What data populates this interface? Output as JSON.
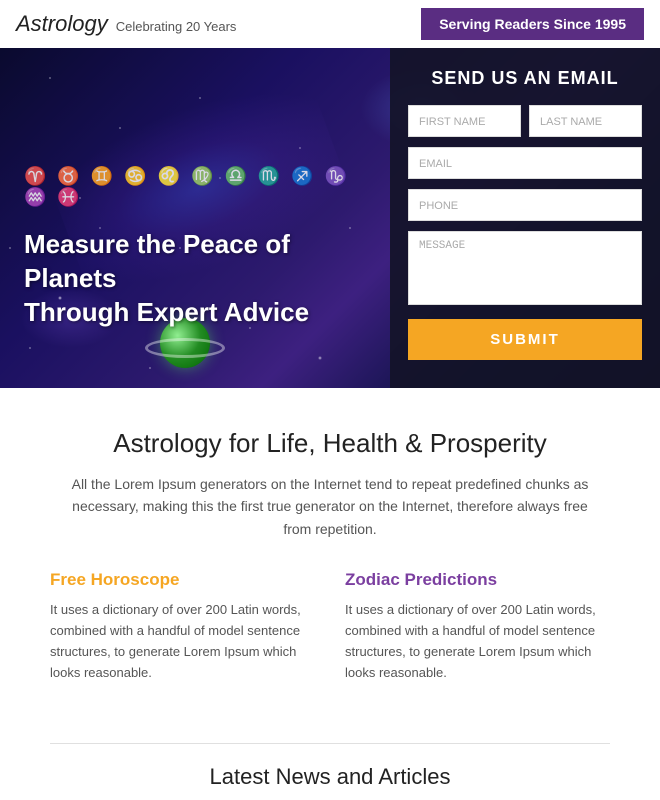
{
  "header": {
    "site_title": "Astrology",
    "site_subtitle": "Celebrating 20 Years",
    "tagline": "Serving Readers Since 1995"
  },
  "hero": {
    "zodiac_symbols": "♈ ♉ ♊ ♋ ♌ ♍ ♎ ♏ ♐ ♑ ♒ ♓",
    "title_line1": "Measure the Peace of Planets",
    "title_line2": "Through Expert Advice"
  },
  "form": {
    "title": "SEND US AN EMAIL",
    "first_name_placeholder": "FIRST NAME",
    "last_name_placeholder": "LAST NAME",
    "email_placeholder": "EMAIL",
    "phone_placeholder": "PHONE",
    "message_placeholder": "Message",
    "submit_label": "SUBMIT"
  },
  "main": {
    "title": "Astrology for Life, Health & Prosperity",
    "description": "All the Lorem Ipsum generators on the Internet tend to repeat predefined chunks as necessary, making this the first true generator on the Internet, therefore always free from repetition."
  },
  "features": [
    {
      "title": "Free Horoscope",
      "color": "orange",
      "text": "It uses a dictionary of over 200 Latin words, combined with a handful of model sentence structures, to generate Lorem Ipsum which looks reasonable."
    },
    {
      "title": "Zodiac Predictions",
      "color": "purple",
      "text": "It uses a dictionary of over 200 Latin words, combined with a handful of model sentence structures, to generate Lorem Ipsum which looks reasonable."
    }
  ],
  "latest_news": {
    "title": "Latest News and Articles"
  }
}
